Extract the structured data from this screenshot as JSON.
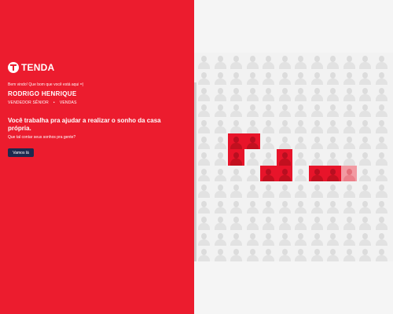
{
  "brand": {
    "name": "TENDA",
    "icon": "tenda-logo-icon"
  },
  "profile": {
    "greeting": "Bem vindo! Que bom que você está aqui =)",
    "name": "RODRIGO HENRIQUE",
    "role": "VENDEDOR SÊNIOR",
    "separator": "•",
    "department": "VENDAS"
  },
  "hero": {
    "headline": "Você trabalha pra ajudar a realizar o sonho da casa própria.",
    "subline": "Que tal contar seus sonhos pra gente?",
    "cta_label": "Vamos lá"
  },
  "colors": {
    "brand_red": "#ec1c2e",
    "button_navy": "#1c2a4f",
    "grid_bg": "#f2f2f2"
  }
}
